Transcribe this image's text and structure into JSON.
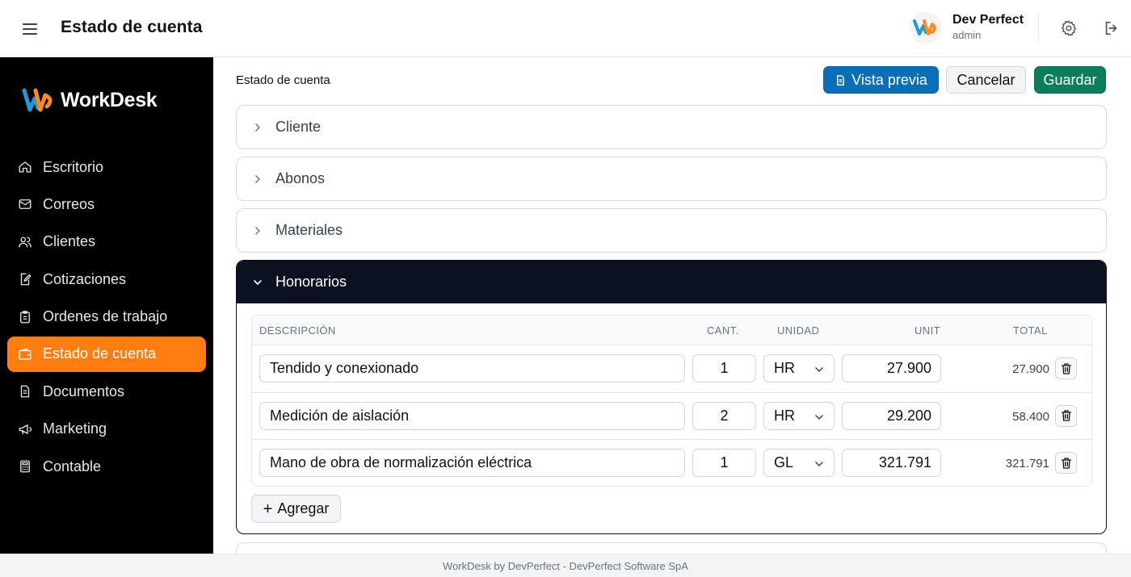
{
  "header": {
    "title": "Estado de cuenta",
    "user_name": "Dev Perfect",
    "user_role": "admin"
  },
  "sidebar": {
    "brand": "WorkDesk",
    "items": [
      {
        "label": "Escritorio",
        "icon": "home-icon"
      },
      {
        "label": "Correos",
        "icon": "mail-icon"
      },
      {
        "label": "Clientes",
        "icon": "users-icon"
      },
      {
        "label": "Cotizaciones",
        "icon": "file-edit-icon"
      },
      {
        "label": "Ordenes de trabajo",
        "icon": "clipboard-icon"
      },
      {
        "label": "Estado de cuenta",
        "icon": "wallet-icon",
        "active": true
      },
      {
        "label": "Documentos",
        "icon": "document-icon"
      },
      {
        "label": "Marketing",
        "icon": "megaphone-icon"
      },
      {
        "label": "Contable",
        "icon": "calculator-icon"
      }
    ]
  },
  "main": {
    "section_title": "Estado de cuenta",
    "preview_label": "Vista previa",
    "cancel_label": "Cancelar",
    "save_label": "Guardar",
    "panels": [
      {
        "label": "Cliente",
        "open": false
      },
      {
        "label": "Abonos",
        "open": false
      },
      {
        "label": "Materiales",
        "open": false
      },
      {
        "label": "Honorarios",
        "open": true
      }
    ],
    "table": {
      "headers": {
        "description": "DESCRIPCIÓN",
        "qty": "CANT.",
        "unit": "UNIDAD",
        "price": "UNIT",
        "total": "TOTAL"
      },
      "rows": [
        {
          "description": "Tendido y conexionado",
          "qty": "1",
          "unit": "HR",
          "price": "27.900",
          "total": "27.900"
        },
        {
          "description": "Medición de aislación",
          "qty": "2",
          "unit": "HR",
          "price": "29.200",
          "total": "58.400"
        },
        {
          "description": "Mano de obra de normalización eléctrica",
          "qty": "1",
          "unit": "GL",
          "price": "321.791",
          "total": "321.791"
        }
      ]
    },
    "add_label": "Agregar"
  },
  "footer": {
    "text": "WorkDesk by DevPerfect - DevPerfect Software SpA"
  },
  "colors": {
    "accent": "#ff7e0f",
    "preview": "#0a6fb7",
    "save": "#0d7c5a",
    "open_panel": "#0b1120"
  }
}
